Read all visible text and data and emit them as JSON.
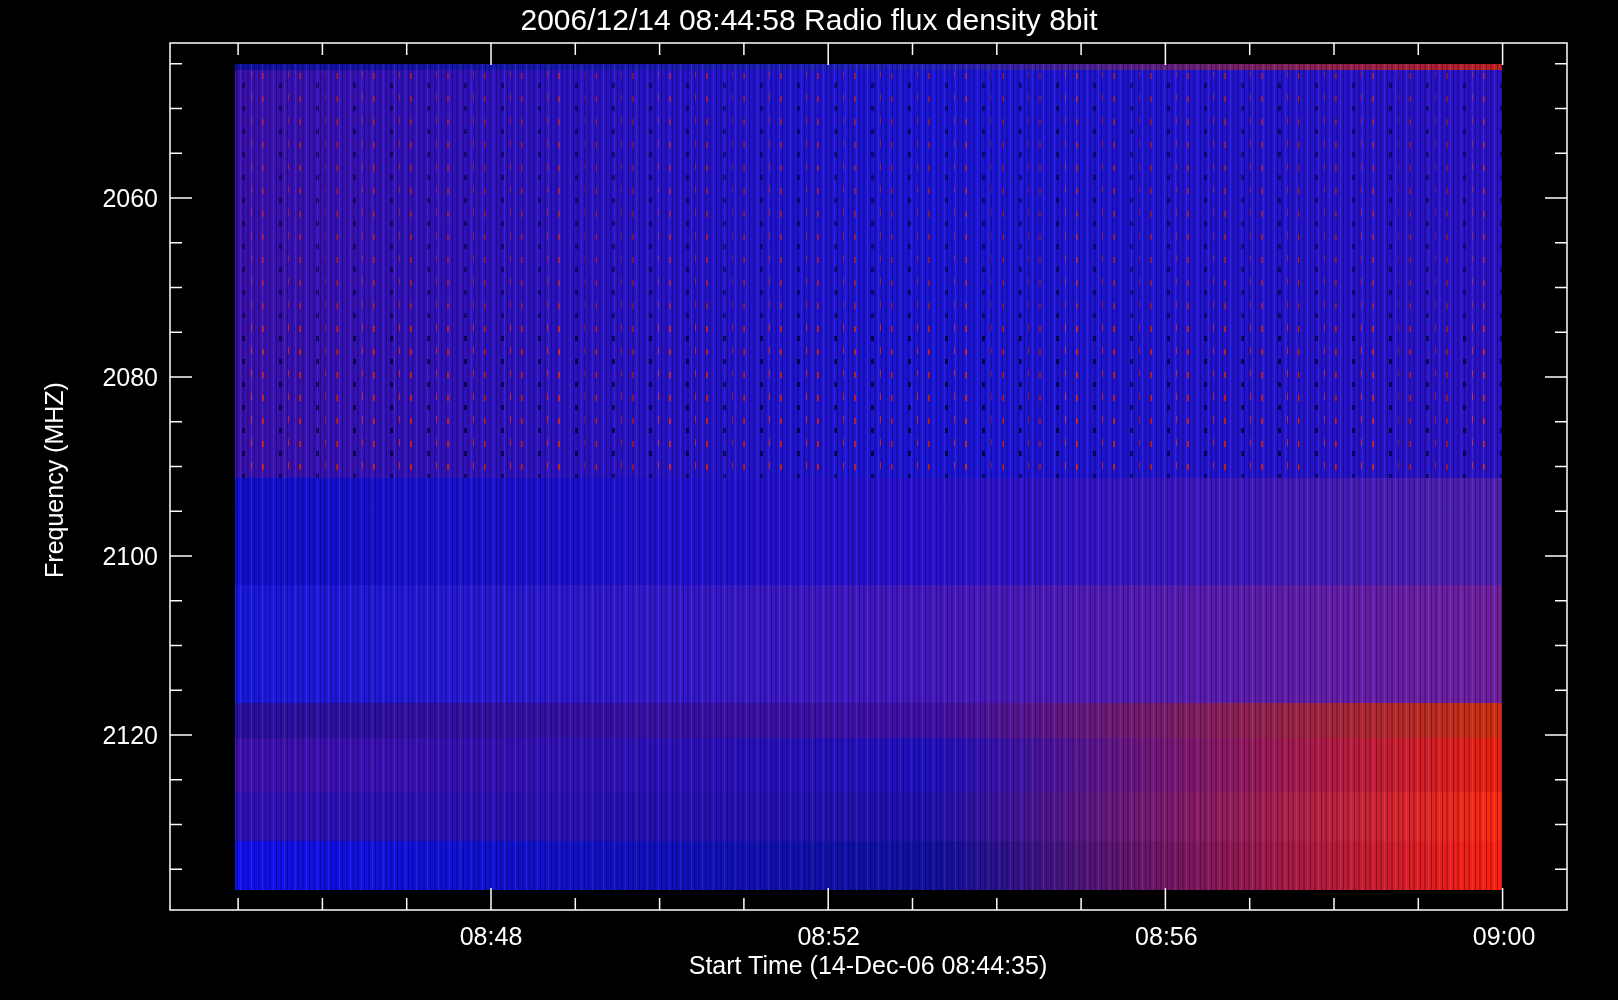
{
  "title": "2006/12/14 08:44:58 Radio flux density 8bit",
  "y_axis": {
    "label": "Frequency (MHZ)",
    "ticks": [
      "2060",
      "2080",
      "2100",
      "2120"
    ]
  },
  "x_axis": {
    "label": "Start Time (14-Dec-06 08:44:35)",
    "ticks": [
      "08:48",
      "08:52",
      "08:56",
      "09:00"
    ]
  }
}
